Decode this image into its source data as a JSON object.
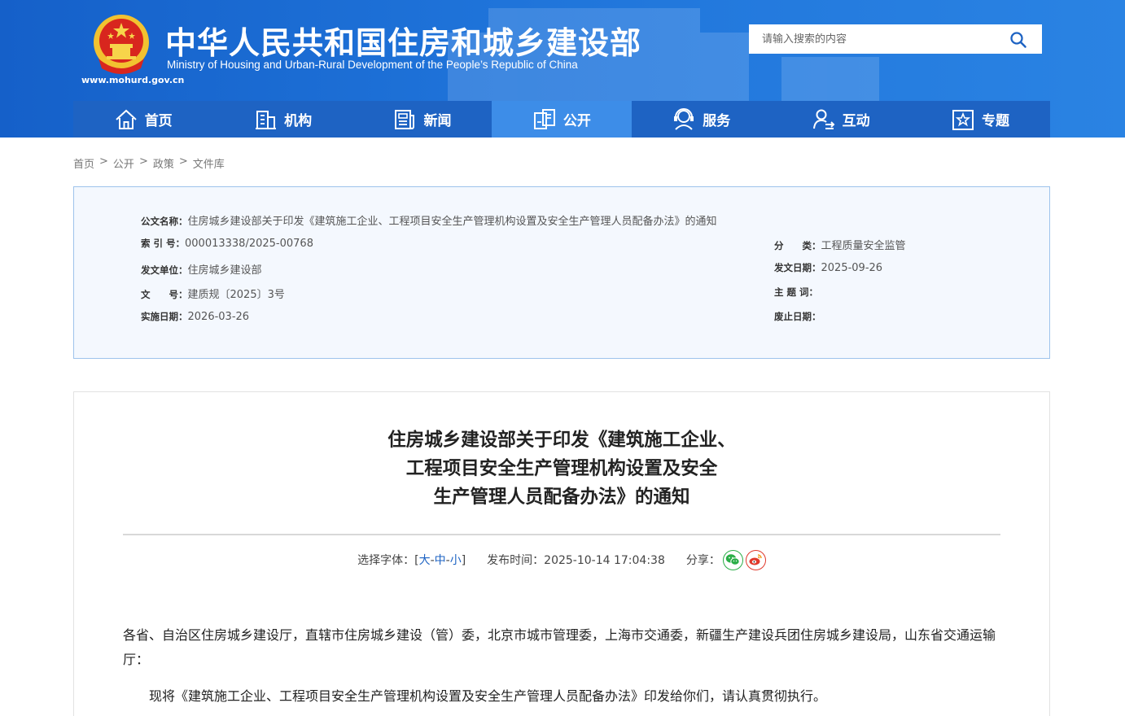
{
  "header": {
    "title": "中华人民共和国住房和城乡建设部",
    "subtitle": "Ministry of Housing and Urban-Rural Development of the People’s Republic of China",
    "url": "www.mohurd.gov.cn",
    "search_placeholder": "请输入搜索的内容",
    "colors": {
      "primary": "#1e63c3",
      "active": "#3d8de8"
    }
  },
  "nav": {
    "items": [
      {
        "label": "首页",
        "icon": "home-icon"
      },
      {
        "label": "机构",
        "icon": "building-icon"
      },
      {
        "label": "新闻",
        "icon": "news-icon"
      },
      {
        "label": "公开",
        "icon": "open-files-icon",
        "active": true
      },
      {
        "label": "服务",
        "icon": "service-icon"
      },
      {
        "label": "互动",
        "icon": "interaction-icon"
      },
      {
        "label": "专题",
        "icon": "topic-star-icon"
      }
    ]
  },
  "breadcrumb": [
    "首页",
    "公开",
    "政策",
    "文件库"
  ],
  "breadcrumb_sep": ">",
  "meta": {
    "doc_name_key": "公文名称：",
    "doc_name": "住房城乡建设部关于印发《建筑施工企业、工程项目安全生产管理机构设置及安全生产管理人员配备办法》的通知",
    "index_key": "索 引 号：",
    "index": "000013338/2025-00768",
    "category_key": "分　　类：",
    "category": "工程质量安全监管",
    "issuer_key": "发文单位：",
    "issuer": "住房城乡建设部",
    "issue_date_key": "发文日期：",
    "issue_date": "2025-09-26",
    "doc_no_key": "文　　号：",
    "doc_no": "建质规〔2025〕3号",
    "keywords_key": "主 题 词：",
    "keywords": "",
    "effective_key": "实施日期：",
    "effective": "2026-03-26",
    "abolish_key": "废止日期：",
    "abolish": ""
  },
  "article": {
    "title_lines": [
      "住房城乡建设部关于印发《建筑施工企业、",
      "工程项目安全生产管理机构设置及安全",
      "生产管理人员配备办法》的通知"
    ],
    "font_label": "选择字体：[",
    "font_large": "大",
    "font_medium": "中",
    "font_small": "小",
    "font_dash": "-",
    "font_close": "]",
    "publish_label": "发布时间：",
    "publish_time": "2025-10-14 17:04:38",
    "share_label": "分享：",
    "paragraphs": [
      "各省、自治区住房城乡建设厅，直辖市住房城乡建设（管）委，北京市城市管理委，上海市交通委，新疆生产建设兵团住房城乡建设局，山东省交通运输厅：",
      "现将《建筑施工企业、工程项目安全生产管理机构设置及安全生产管理人员配备办法》印发给你们，请认真贯彻执行。"
    ]
  }
}
